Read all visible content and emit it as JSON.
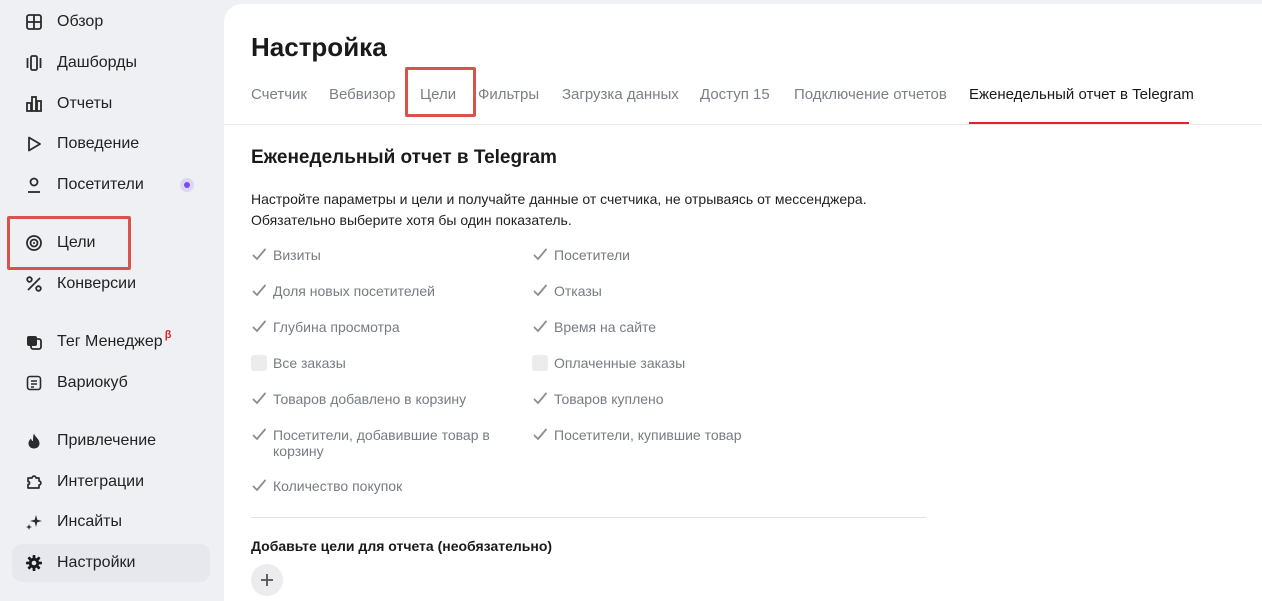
{
  "sidebar": {
    "items": [
      {
        "id": "overview",
        "label": "Обзор",
        "icon": "grid-icon"
      },
      {
        "id": "dashboards",
        "label": "Дашборды",
        "icon": "dashboards-icon"
      },
      {
        "id": "reports",
        "label": "Отчеты",
        "icon": "bar-chart-icon"
      },
      {
        "id": "behavior",
        "label": "Поведение",
        "icon": "play-icon"
      },
      {
        "id": "visitors",
        "label": "Посетители",
        "icon": "user-icon"
      },
      {
        "id": "goals",
        "label": "Цели",
        "icon": "target-icon"
      },
      {
        "id": "conversions",
        "label": "Конверсии",
        "icon": "percent-icon"
      },
      {
        "id": "tag-manager",
        "label": "Тег Менеджер",
        "badge": "β",
        "icon": "tag-manager-icon"
      },
      {
        "id": "variocube",
        "label": "Вариокуб",
        "icon": "variocube-icon"
      },
      {
        "id": "acquisition",
        "label": "Привлечение",
        "icon": "fire-icon"
      },
      {
        "id": "integrations",
        "label": "Интеграции",
        "icon": "puzzle-icon"
      },
      {
        "id": "insights",
        "label": "Инсайты",
        "icon": "sparkle-icon"
      },
      {
        "id": "settings",
        "label": "Настройки",
        "icon": "gear-icon"
      }
    ],
    "active": "settings"
  },
  "page": {
    "title": "Настройка",
    "tabs": [
      "Счетчик",
      "Вебвизор",
      "Цели",
      "Фильтры",
      "Загрузка данных",
      "Доступ 15",
      "Подключение отчетов",
      "Еженедельный отчет в Telegram"
    ],
    "active_tab": "Еженедельный отчет в Telegram"
  },
  "report": {
    "title": "Еженедельный отчет в Telegram",
    "desc_line1": "Настройте параметры и цели и получайте данные от счетчика, не отрываясь от мессенджера.",
    "desc_line2": "Обязательно выберите хотя бы один показатель.",
    "metrics": [
      {
        "label": "Визиты",
        "checked": true
      },
      {
        "label": "Посетители",
        "checked": true
      },
      {
        "label": "Доля новых посетителей",
        "checked": true
      },
      {
        "label": "Отказы",
        "checked": true
      },
      {
        "label": "Глубина просмотра",
        "checked": true
      },
      {
        "label": "Время на сайте",
        "checked": true
      },
      {
        "label": "Все заказы",
        "checked": false
      },
      {
        "label": "Оплаченные заказы",
        "checked": false
      },
      {
        "label": "Товаров добавлено в корзину",
        "checked": true
      },
      {
        "label": "Товаров куплено",
        "checked": true
      },
      {
        "label": "Посетители, добавившие товар в корзину",
        "checked": true
      },
      {
        "label": "Посетители, купившие товар",
        "checked": true
      },
      {
        "label": "Количество покупок",
        "checked": true
      }
    ],
    "add_goals_title": "Добавьте цели для отчета (необязательно)"
  },
  "colors": {
    "accent": "#e0242a",
    "highlight": "#d8544b",
    "badge": "#7a4df0"
  }
}
